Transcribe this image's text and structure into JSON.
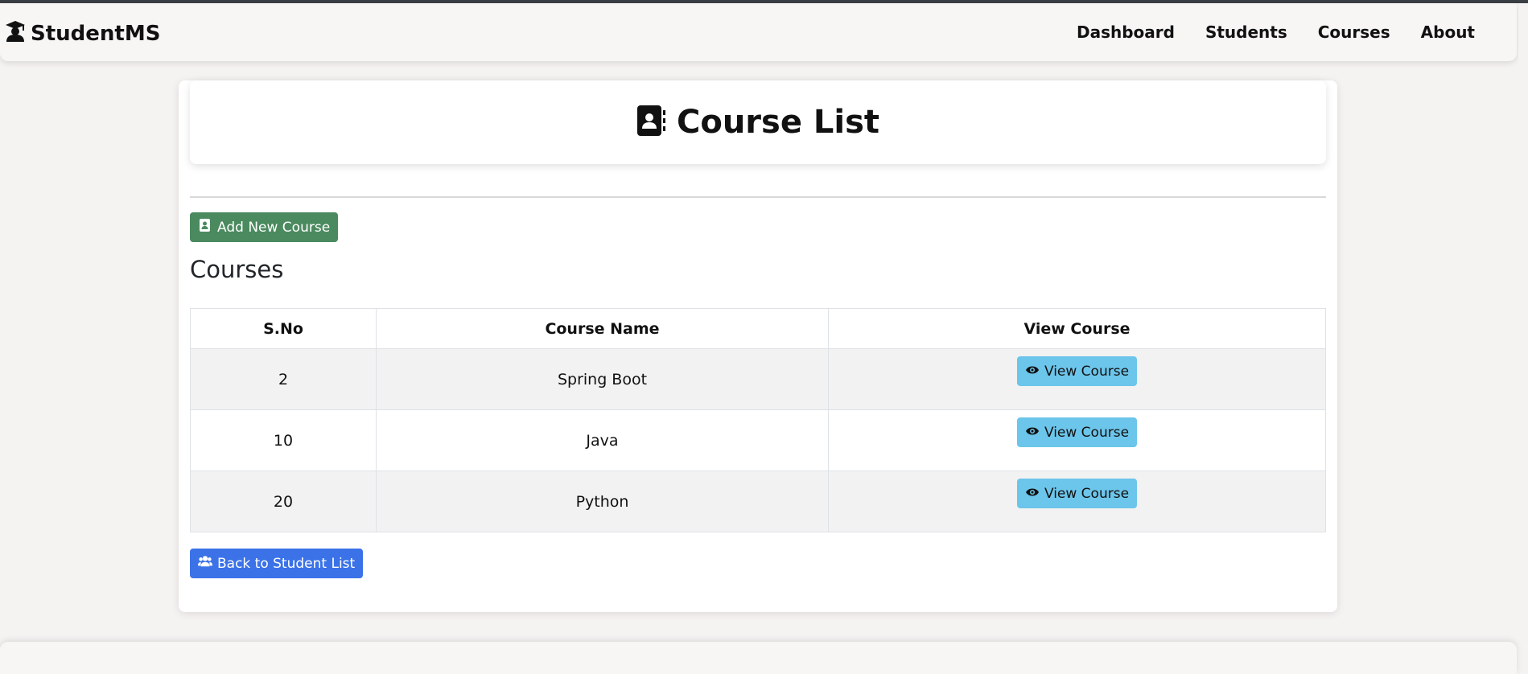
{
  "brand": {
    "name": "StudentMS",
    "icon": "graduate-icon"
  },
  "nav": {
    "items": [
      "Dashboard",
      "Students",
      "Courses",
      "About"
    ]
  },
  "header": {
    "title": "Course List",
    "icon": "address-book-icon"
  },
  "actions": {
    "add_label": "Add New Course",
    "back_label": "Back to Student List"
  },
  "section": {
    "title": "Courses"
  },
  "table": {
    "headers": [
      "S.No",
      "Course Name",
      "View Course"
    ],
    "rows": [
      {
        "sno": "2",
        "name": "Spring Boot",
        "action": "View Course"
      },
      {
        "sno": "10",
        "name": "Java",
        "action": "View Course"
      },
      {
        "sno": "20",
        "name": "Python",
        "action": "View Course"
      }
    ]
  },
  "colors": {
    "add_button": "#4a8a5e",
    "view_button": "#6cc5ea",
    "back_button": "#3b72e8"
  }
}
